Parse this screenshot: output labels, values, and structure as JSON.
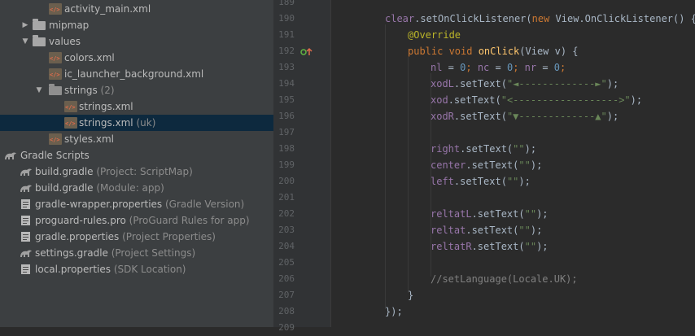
{
  "colors": {
    "tree_bg": "#3c3f41",
    "selected_row": "#0d293e",
    "editor_bg": "#2b2b2b",
    "keyword": "#cc7832",
    "field": "#9876aa",
    "string": "#6a8759",
    "number": "#6897bb",
    "annotation": "#bbb529",
    "method": "#ffc66d",
    "comment": "#808080"
  },
  "project_tree": [
    {
      "name": "activity_main.xml",
      "hint": "",
      "icon": "xml-file-icon"
    },
    {
      "name": "mipmap",
      "hint": "",
      "icon": "folder-icon"
    },
    {
      "name": "values",
      "hint": "",
      "icon": "folder-icon"
    },
    {
      "name": "colors.xml",
      "hint": "",
      "icon": "xml-file-icon"
    },
    {
      "name": "ic_launcher_background.xml",
      "hint": "",
      "icon": "xml-file-icon"
    },
    {
      "name": "strings",
      "hint": " (2)",
      "icon": "folder-icon"
    },
    {
      "name": "strings.xml",
      "hint": "",
      "icon": "xml-file-icon"
    },
    {
      "name": "strings.xml",
      "hint": " (uk)",
      "icon": "xml-file-icon"
    },
    {
      "name": "styles.xml",
      "hint": "",
      "icon": "xml-file-icon"
    },
    {
      "name": "Gradle Scripts",
      "hint": "",
      "icon": "gradle-icon"
    },
    {
      "name": "build.gradle",
      "hint": " (Project: ScriptMap)",
      "icon": "gradle-icon"
    },
    {
      "name": "build.gradle",
      "hint": " (Module: app)",
      "icon": "gradle-icon"
    },
    {
      "name": "gradle-wrapper.properties",
      "hint": " (Gradle Version)",
      "icon": "properties-icon"
    },
    {
      "name": "proguard-rules.pro",
      "hint": " (ProGuard Rules for app)",
      "icon": "properties-icon"
    },
    {
      "name": "gradle.properties",
      "hint": " (Project Properties)",
      "icon": "properties-icon"
    },
    {
      "name": "settings.gradle",
      "hint": " (Project Settings)",
      "icon": "gradle-icon"
    },
    {
      "name": "local.properties",
      "hint": " (SDK Location)",
      "icon": "properties-icon"
    }
  ],
  "line_numbers": [
    "189",
    "190",
    "191",
    "192",
    "193",
    "194",
    "195",
    "196",
    "197",
    "198",
    "199",
    "200",
    "201",
    "202",
    "203",
    "204",
    "205",
    "206",
    "207",
    "208",
    "209"
  ],
  "code_lines": [
    {
      "tokens": []
    },
    {
      "tokens": [
        {
          "t": "clear",
          "c": "fld"
        },
        {
          "t": ".setOnClickListener(",
          "c": ""
        },
        {
          "t": "new ",
          "c": "kw"
        },
        {
          "t": "View.OnClickListener() {",
          "c": ""
        }
      ]
    },
    {
      "tokens": [
        {
          "t": "@Override",
          "c": "ann"
        }
      ]
    },
    {
      "tokens": [
        {
          "t": "public void ",
          "c": "kw"
        },
        {
          "t": "onClick",
          "c": "fn"
        },
        {
          "t": "(View v) {",
          "c": ""
        }
      ]
    },
    {
      "tokens": [
        {
          "t": "nl",
          "c": "fld"
        },
        {
          "t": " = ",
          "c": ""
        },
        {
          "t": "0",
          "c": "num"
        },
        {
          "t": "; ",
          "c": "kw"
        },
        {
          "t": "nc",
          "c": "fld"
        },
        {
          "t": " = ",
          "c": ""
        },
        {
          "t": "0",
          "c": "num"
        },
        {
          "t": "; ",
          "c": "kw"
        },
        {
          "t": "nr",
          "c": "fld"
        },
        {
          "t": " = ",
          "c": ""
        },
        {
          "t": "0",
          "c": "num"
        },
        {
          "t": ";",
          "c": "kw"
        }
      ]
    },
    {
      "tokens": [
        {
          "t": "xodL",
          "c": "fld"
        },
        {
          "t": ".setText(",
          "c": ""
        },
        {
          "t": "\"◄-------------►\"",
          "c": "str"
        },
        {
          "t": ");",
          "c": ""
        }
      ]
    },
    {
      "tokens": [
        {
          "t": "xod",
          "c": "fld"
        },
        {
          "t": ".setText(",
          "c": ""
        },
        {
          "t": "\"<------------------>\"",
          "c": "str"
        },
        {
          "t": ");",
          "c": ""
        }
      ]
    },
    {
      "tokens": [
        {
          "t": "xodR",
          "c": "fld"
        },
        {
          "t": ".setText(",
          "c": ""
        },
        {
          "t": "\"▼-------------▲\"",
          "c": "str"
        },
        {
          "t": ");",
          "c": ""
        }
      ]
    },
    {
      "tokens": []
    },
    {
      "tokens": [
        {
          "t": "right",
          "c": "fld"
        },
        {
          "t": ".setText(",
          "c": ""
        },
        {
          "t": "\"\"",
          "c": "str"
        },
        {
          "t": ");",
          "c": ""
        }
      ]
    },
    {
      "tokens": [
        {
          "t": "center",
          "c": "fld"
        },
        {
          "t": ".setText(",
          "c": ""
        },
        {
          "t": "\"\"",
          "c": "str"
        },
        {
          "t": ");",
          "c": ""
        }
      ]
    },
    {
      "tokens": [
        {
          "t": "left",
          "c": "fld"
        },
        {
          "t": ".setText(",
          "c": ""
        },
        {
          "t": "\"\"",
          "c": "str"
        },
        {
          "t": ");",
          "c": ""
        }
      ]
    },
    {
      "tokens": []
    },
    {
      "tokens": [
        {
          "t": "reltatL",
          "c": "fld"
        },
        {
          "t": ".setText(",
          "c": ""
        },
        {
          "t": "\"\"",
          "c": "str"
        },
        {
          "t": ");",
          "c": ""
        }
      ]
    },
    {
      "tokens": [
        {
          "t": "reltat",
          "c": "fld"
        },
        {
          "t": ".setText(",
          "c": ""
        },
        {
          "t": "\"\"",
          "c": "str"
        },
        {
          "t": ");",
          "c": ""
        }
      ]
    },
    {
      "tokens": [
        {
          "t": "reltatR",
          "c": "fld"
        },
        {
          "t": ".setText(",
          "c": ""
        },
        {
          "t": "\"\"",
          "c": "str"
        },
        {
          "t": ");",
          "c": ""
        }
      ]
    },
    {
      "tokens": []
    },
    {
      "tokens": [
        {
          "t": "//setLanguage(Locale.UK);",
          "c": "cmt"
        }
      ]
    },
    {
      "tokens": [
        {
          "t": "}",
          "c": ""
        }
      ]
    },
    {
      "tokens": [
        {
          "t": "});",
          "c": ""
        }
      ]
    },
    {
      "tokens": []
    }
  ]
}
